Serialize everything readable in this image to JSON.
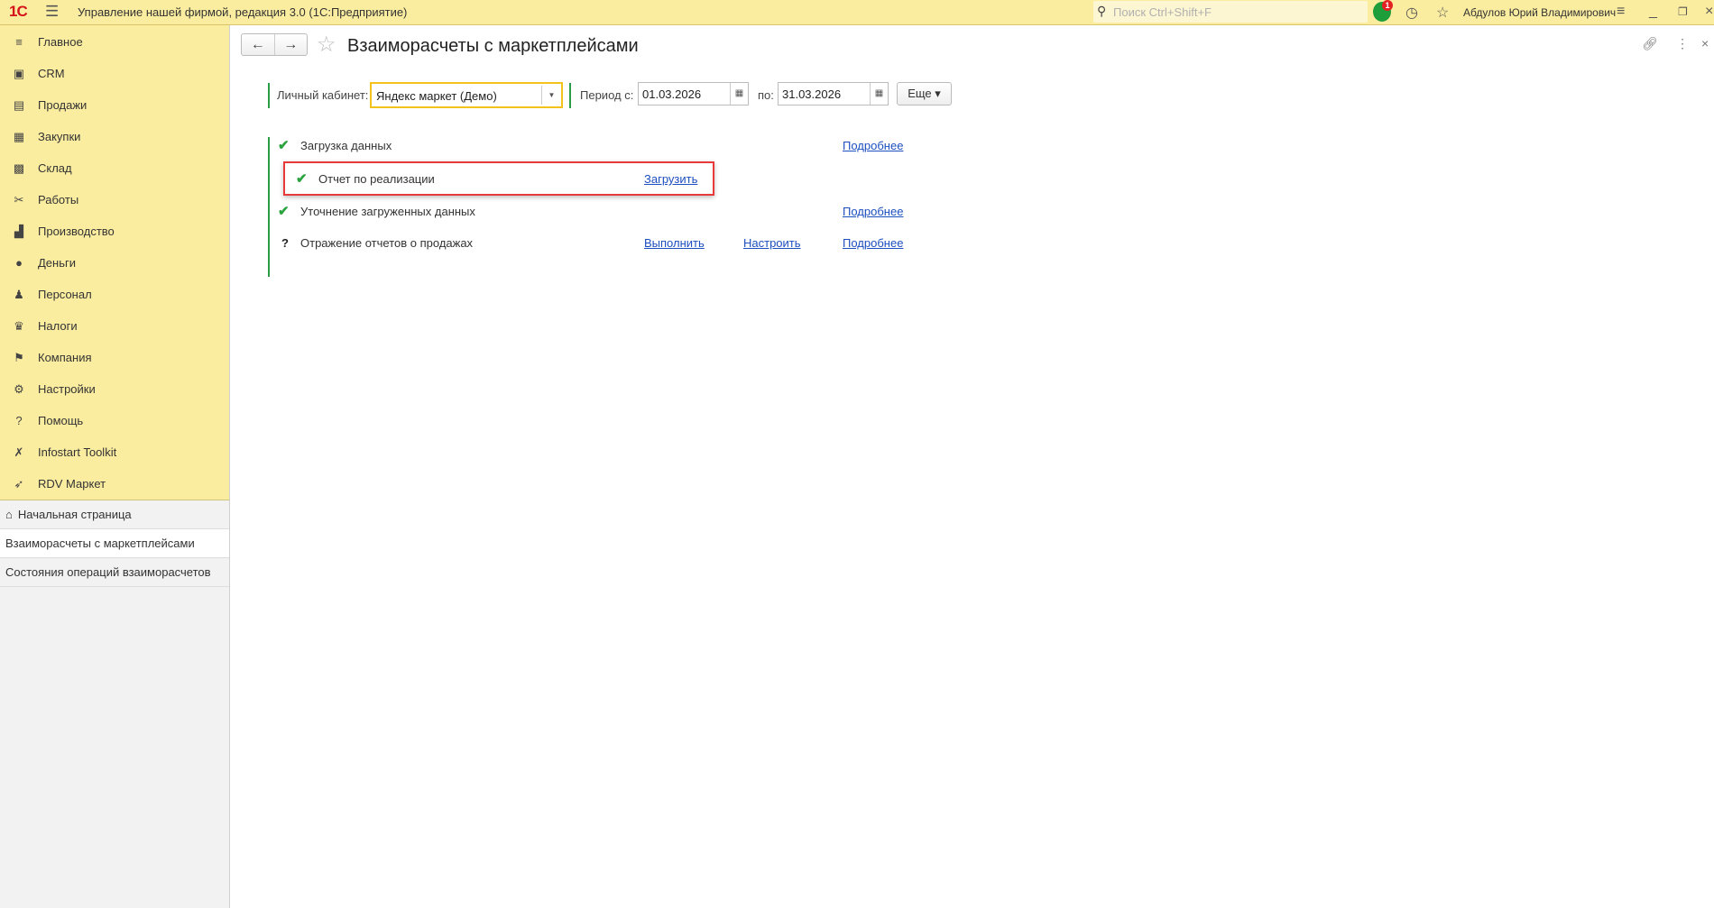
{
  "app": {
    "logo": "1С",
    "title": "Управление нашей фирмой, редакция 3.0  (1С:Предприятие)",
    "search_placeholder": "Поиск Ctrl+Shift+F",
    "notifications": "1",
    "user": "Абдулов Юрий Владимирович"
  },
  "sidebar": {
    "menu": [
      {
        "label": "Главное",
        "icon": "≡"
      },
      {
        "label": "CRM",
        "icon": "▣"
      },
      {
        "label": "Продажи",
        "icon": "▤"
      },
      {
        "label": "Закупки",
        "icon": "▦"
      },
      {
        "label": "Склад",
        "icon": "▩"
      },
      {
        "label": "Работы",
        "icon": "✂"
      },
      {
        "label": "Производство",
        "icon": "▟"
      },
      {
        "label": "Деньги",
        "icon": "●"
      },
      {
        "label": "Персонал",
        "icon": "♟"
      },
      {
        "label": "Налоги",
        "icon": "♛"
      },
      {
        "label": "Компания",
        "icon": "⚑"
      },
      {
        "label": "Настройки",
        "icon": "⚙"
      },
      {
        "label": "Помощь",
        "icon": "?"
      },
      {
        "label": "Infostart Toolkit",
        "icon": "✗"
      },
      {
        "label": "RDV Маркет",
        "icon": "➶"
      }
    ],
    "nav": [
      {
        "label": "Начальная страница",
        "icon": "⌂"
      },
      {
        "label": "Взаиморасчеты с маркетплейсами"
      },
      {
        "label": "Состояния операций взаиморасчетов"
      }
    ]
  },
  "form": {
    "title": "Взаиморасчеты с маркетплейсами",
    "cabinet_label": "Личный кабинет:",
    "cabinet_value": "Яндекс маркет (Демо)",
    "period_label": "Период с:",
    "date_from": "01.03.2026",
    "to_label": "по:",
    "date_to": "31.03.2026",
    "more": "Еще ▾"
  },
  "steps": [
    {
      "status": "✔",
      "label": "Загрузка данных",
      "details": "Подробнее"
    },
    {
      "status": "✔",
      "label": "Отчет по реализации",
      "action": "Загрузить"
    },
    {
      "status": "✔",
      "label": "Уточнение загруженных данных",
      "details": "Подробнее"
    },
    {
      "status": "?",
      "label": "Отражение отчетов о продажах",
      "run": "Выполнить",
      "configure": "Настроить",
      "details": "Подробнее"
    }
  ]
}
